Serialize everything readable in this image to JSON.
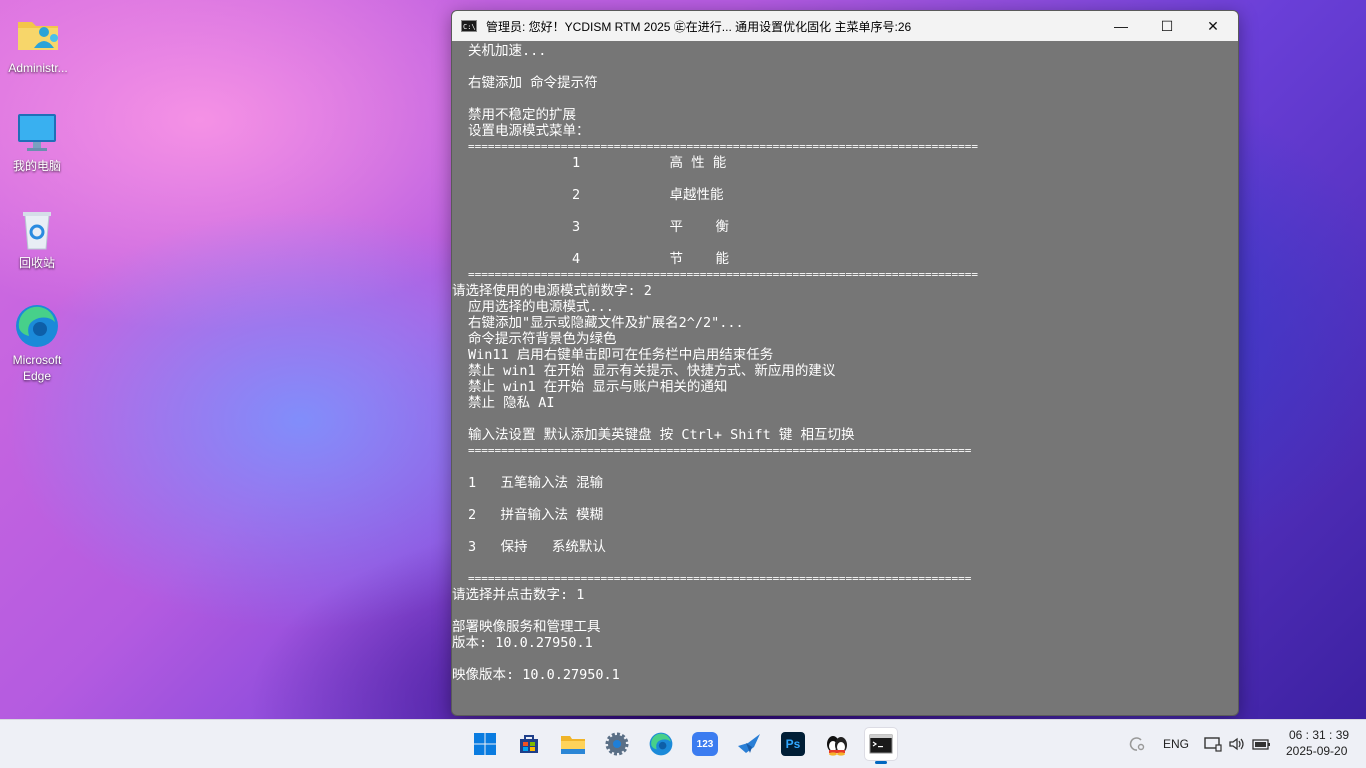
{
  "desktop": {
    "icons": [
      {
        "label": "Administr...",
        "icon": "user-folder-icon"
      },
      {
        "label": "我的电脑",
        "icon": "computer-icon"
      },
      {
        "label": "回收站",
        "icon": "recycle-bin-icon"
      },
      {
        "label": "Microsoft Edge",
        "icon": "edge-icon"
      }
    ]
  },
  "window": {
    "title": "管理员:   您好！YCDISM RTM 2025 ㊣在进行... 通用设置优化固化   主菜单序号:26",
    "controls": {
      "minimize": "—",
      "maximize": "☐",
      "close": "✕"
    },
    "console_lines": [
      "关机加速...",
      "右键添加 命令提示符",
      "禁用不稳定的扩展",
      "设置电源模式菜单：",
      "=============================================================================",
      "1           高 性 能",
      "2           卓越性能",
      "3           平    衡",
      "4           节    能",
      "=============================================================================",
      "请选择使用的电源模式前数字: 2",
      "应用选择的电源模式...",
      "右键添加\"显示或隐藏文件及扩展名2^/2\"...",
      "命令提示符背景色为绿色",
      "Win11 启用右键单击即可在任务栏中启用结束任务",
      "禁止 win1 在开始 显示有关提示、快捷方式、新应用的建议",
      "禁止 win1 在开始 显示与账户相关的通知",
      "禁止 隐私 AI",
      "输入法设置 默认添加美英键盘 按 Ctrl+ Shift 键 相互切换",
      "============================================================================",
      "1   五笔输入法 混输",
      "2   拼音输入法 模糊",
      "3   保持   系统默认",
      "============================================================================",
      "请选择并点击数字: 1",
      "部署映像服务和管理工具",
      "版本: 10.0.27950.1",
      "映像版本: 10.0.27950.1"
    ]
  },
  "taskbar": {
    "apps": [
      {
        "name": "start-button",
        "icon": "windows-logo-icon"
      },
      {
        "name": "store-app",
        "icon": "store-icon"
      },
      {
        "name": "file-explorer-app",
        "icon": "folder-icon"
      },
      {
        "name": "settings-app",
        "icon": "gear-icon"
      },
      {
        "name": "edge-app",
        "icon": "edge-icon"
      },
      {
        "name": "123-app",
        "icon": "123-icon"
      },
      {
        "name": "feishu-app",
        "icon": "bird-icon"
      },
      {
        "name": "photoshop-app",
        "icon": "ps-icon"
      },
      {
        "name": "qq-app",
        "icon": "penguin-icon"
      },
      {
        "name": "terminal-app",
        "icon": "terminal-icon"
      }
    ],
    "ps_label": "Ps",
    "app123_label": "123",
    "tray": {
      "language": "ENG",
      "time": "06 : 31 : 39",
      "date": "2025-09-20"
    }
  }
}
